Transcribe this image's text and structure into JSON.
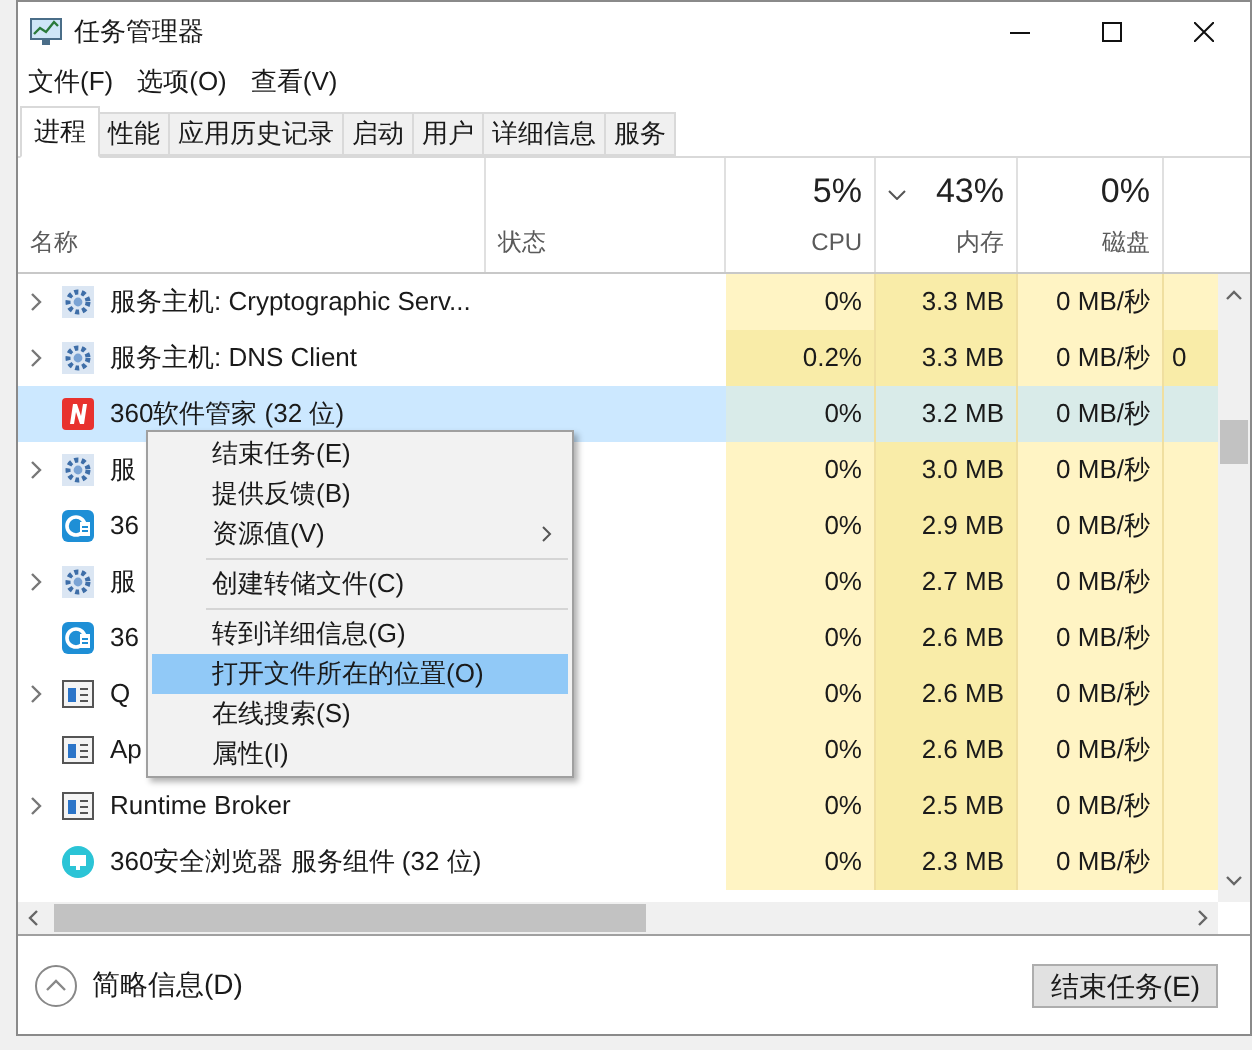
{
  "window": {
    "title": "任务管理器"
  },
  "menu_bar": [
    "文件(F)",
    "选项(O)",
    "查看(V)"
  ],
  "tabs": [
    {
      "label": "进程",
      "selected": true
    },
    {
      "label": "性能",
      "selected": false
    },
    {
      "label": "应用历史记录",
      "selected": false
    },
    {
      "label": "启动",
      "selected": false
    },
    {
      "label": "用户",
      "selected": false
    },
    {
      "label": "详细信息",
      "selected": false
    },
    {
      "label": "服务",
      "selected": false
    }
  ],
  "table": {
    "columns": [
      {
        "label": "名称"
      },
      {
        "label": "状态"
      },
      {
        "usage": "5%",
        "label": "CPU",
        "sorted": false
      },
      {
        "usage": "43%",
        "label": "内存",
        "sorted": true
      },
      {
        "usage": "0%",
        "label": "磁盘",
        "sorted": false
      }
    ],
    "rows": [
      {
        "kind": "gear",
        "expandable": true,
        "selected": false,
        "name": "服务主机: Cryptographic Serv...",
        "cpu": "0%",
        "cpu_busy": false,
        "memory": "3.3 MB",
        "disk": "0 MB/秒"
      },
      {
        "kind": "gear",
        "expandable": true,
        "selected": false,
        "name": "服务主机: DNS Client",
        "cpu": "0.2%",
        "cpu_busy": true,
        "memory": "3.3 MB",
        "disk": "0 MB/秒",
        "column_5": "0"
      },
      {
        "kind": "red-n",
        "expandable": false,
        "selected": true,
        "name": "360软件管家 (32 位)",
        "cpu": "0%",
        "cpu_busy": false,
        "memory": "3.2 MB",
        "disk": "0 MB/秒"
      },
      {
        "kind": "gear",
        "expandable": true,
        "selected": false,
        "name": "服",
        "cpu": "0%",
        "cpu_busy": false,
        "memory": "3.0 MB",
        "disk": "0 MB/秒"
      },
      {
        "kind": "browser",
        "expandable": false,
        "selected": false,
        "name": "36",
        "cpu": "0%",
        "cpu_busy": false,
        "memory": "2.9 MB",
        "disk": "0 MB/秒"
      },
      {
        "kind": "gear",
        "expandable": true,
        "selected": false,
        "name": "服",
        "cpu": "0%",
        "cpu_busy": false,
        "memory": "2.7 MB",
        "disk": "0 MB/秒"
      },
      {
        "kind": "browser",
        "expandable": false,
        "selected": false,
        "name": "36",
        "cpu": "0%",
        "cpu_busy": false,
        "memory": "2.6 MB",
        "disk": "0 MB/秒"
      },
      {
        "kind": "window",
        "expandable": true,
        "selected": false,
        "name": "Q",
        "cpu": "0%",
        "cpu_busy": false,
        "memory": "2.6 MB",
        "disk": "0 MB/秒"
      },
      {
        "kind": "window",
        "expandable": false,
        "selected": false,
        "name": "Ap",
        "cpu": "0%",
        "cpu_busy": false,
        "memory": "2.6 MB",
        "disk": "0 MB/秒"
      },
      {
        "kind": "window",
        "expandable": true,
        "selected": false,
        "name": "Runtime Broker",
        "cpu": "0%",
        "cpu_busy": false,
        "memory": "2.5 MB",
        "disk": "0 MB/秒"
      },
      {
        "kind": "monitor",
        "expandable": false,
        "selected": false,
        "name": "360安全浏览器 服务组件 (32 位)",
        "cpu": "0%",
        "cpu_busy": false,
        "memory": "2.3 MB",
        "disk": "0 MB/秒"
      }
    ]
  },
  "context_menu": [
    {
      "kind": "item",
      "label": "结束任务(E)",
      "selected": false
    },
    {
      "kind": "item",
      "label": "提供反馈(B)",
      "selected": false
    },
    {
      "kind": "submenu",
      "label": "资源值(V)",
      "selected": false
    },
    {
      "kind": "separator"
    },
    {
      "kind": "item",
      "label": "创建转储文件(C)",
      "selected": false
    },
    {
      "kind": "separator"
    },
    {
      "kind": "item",
      "label": "转到详细信息(G)",
      "selected": false
    },
    {
      "kind": "item",
      "label": "打开文件所在的位置(O)",
      "selected": true
    },
    {
      "kind": "item",
      "label": "在线搜索(S)",
      "selected": false
    },
    {
      "kind": "item",
      "label": "属性(I)",
      "selected": false
    }
  ],
  "footer": {
    "details_toggle": "简略信息(D)",
    "end_task_button": "结束任务(E)"
  }
}
